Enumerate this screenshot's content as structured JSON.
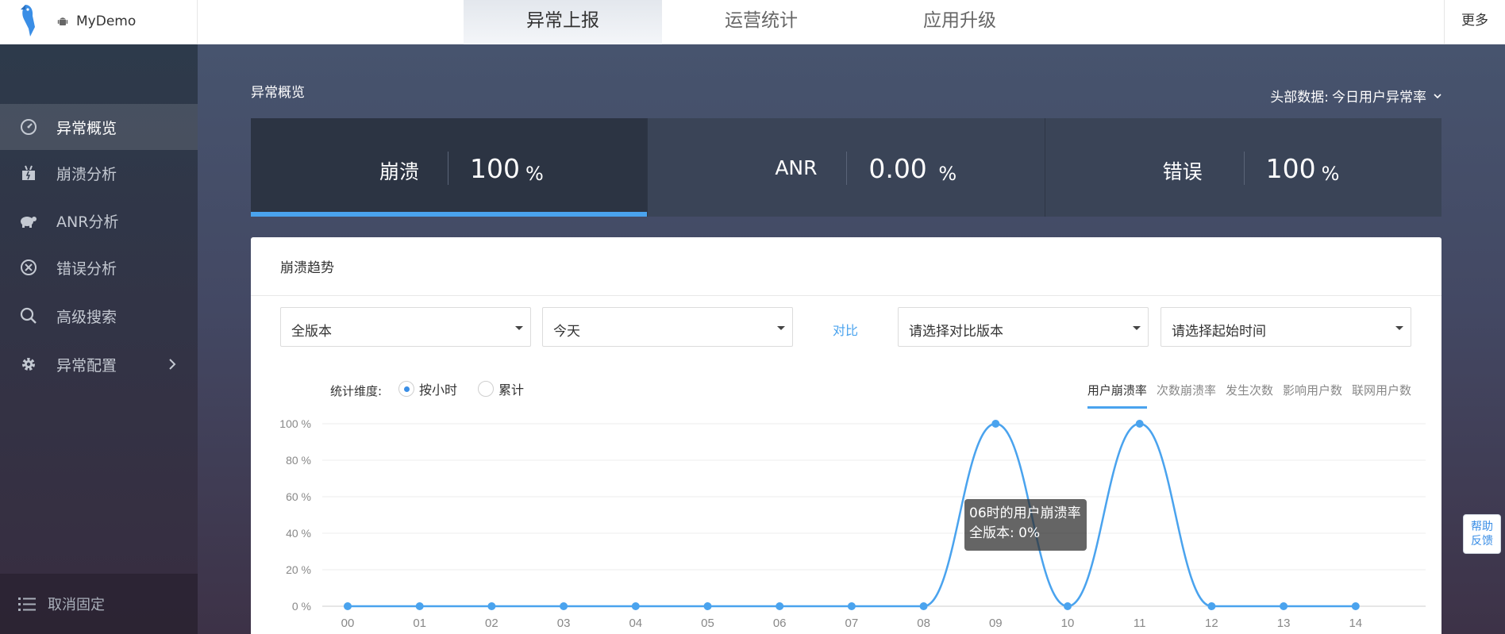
{
  "header": {
    "app_name": "MyDemo",
    "tabs": [
      {
        "label": "异常上报",
        "active": true
      },
      {
        "label": "运营统计",
        "active": false
      },
      {
        "label": "应用升级",
        "active": false
      }
    ],
    "more": "更多"
  },
  "sidebar": {
    "items": [
      {
        "label": "异常概览",
        "icon": "dashboard-icon",
        "active": true
      },
      {
        "label": "崩溃分析",
        "icon": "crash-icon",
        "active": false
      },
      {
        "label": "ANR分析",
        "icon": "turtle-icon",
        "active": false
      },
      {
        "label": "错误分析",
        "icon": "error-circle-icon",
        "active": false
      },
      {
        "label": "高级搜索",
        "icon": "search-icon",
        "active": false
      },
      {
        "label": "异常配置",
        "icon": "gear-icon",
        "active": false
      }
    ],
    "unpin": "取消固定"
  },
  "overview": {
    "title": "异常概览",
    "head_data_label": "头部数据:",
    "head_data_value": "今日用户异常率"
  },
  "stats": [
    {
      "label": "崩溃",
      "value": "100",
      "unit": "%",
      "active": true
    },
    {
      "label": "ANR",
      "value": "0.00",
      "unit": "%",
      "active": false
    },
    {
      "label": "错误",
      "value": "100",
      "unit": "%",
      "active": false
    }
  ],
  "trend": {
    "title": "崩溃趋势",
    "version_select": "全版本",
    "date_select": "今天",
    "compare_label": "对比",
    "compare_version_placeholder": "请选择对比版本",
    "start_time_placeholder": "请选择起始时间",
    "dimension_label": "统计维度:",
    "dimension_options": [
      {
        "label": "按小时",
        "selected": true
      },
      {
        "label": "累计",
        "selected": false
      }
    ],
    "metric_tabs": [
      {
        "label": "用户崩溃率",
        "active": true
      },
      {
        "label": "次数崩溃率",
        "active": false
      },
      {
        "label": "发生次数",
        "active": false
      },
      {
        "label": "影响用户数",
        "active": false
      },
      {
        "label": "联网用户数",
        "active": false
      }
    ]
  },
  "tooltip": {
    "line1": "06时的用户崩溃率",
    "line2": "全版本:   0%"
  },
  "feedback": {
    "line1": "帮助",
    "line2": "反馈"
  },
  "colors": {
    "accent": "#4aa3ee",
    "sidebar_bg": "#2d3a4b"
  },
  "chart_data": {
    "type": "line",
    "categories": [
      "00",
      "01",
      "02",
      "03",
      "04",
      "05",
      "06",
      "07",
      "08",
      "09",
      "10",
      "11",
      "12",
      "13",
      "14"
    ],
    "series": [
      {
        "values": [
          0,
          0,
          0,
          0,
          0,
          0,
          0,
          0,
          0,
          100,
          0,
          100,
          0,
          0,
          0
        ]
      }
    ],
    "y_ticks": [
      "0 %",
      "20 %",
      "40 %",
      "60 %",
      "80 %",
      "100 %"
    ],
    "ylim": [
      0,
      100
    ],
    "grid": true,
    "color": "#4aa3ee"
  }
}
